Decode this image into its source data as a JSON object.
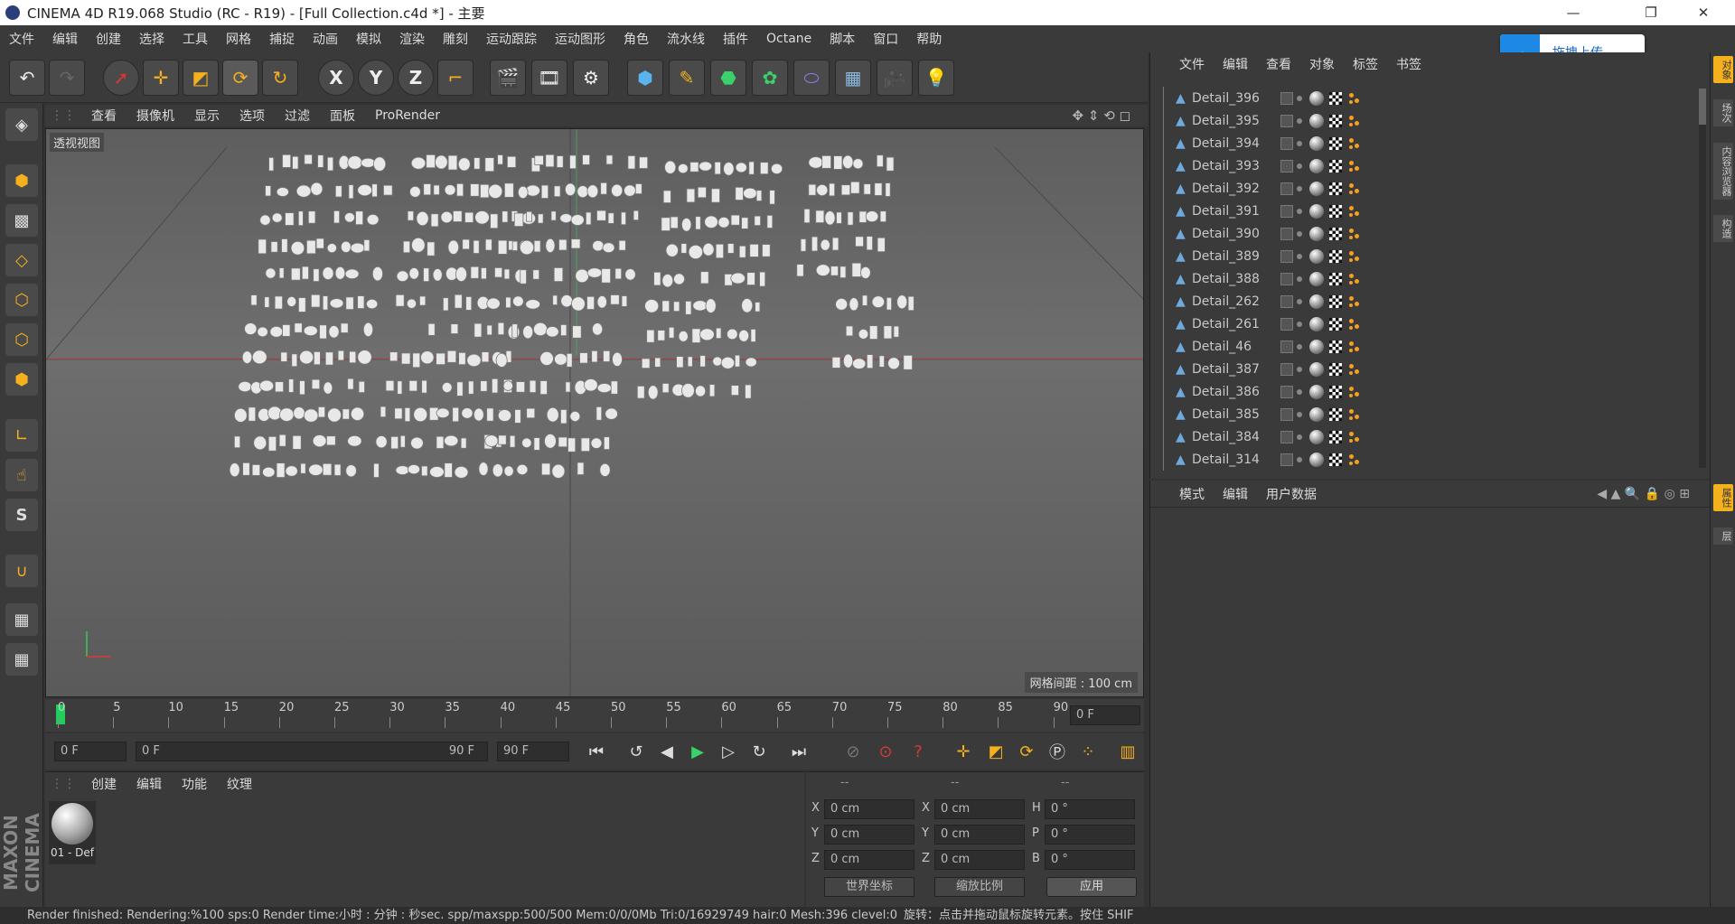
{
  "window": {
    "title": "CINEMA 4D R19.068 Studio (RC - R19) - [Full Collection.c4d *] - 主要",
    "minimize": "—",
    "restore": "❐",
    "close": "✕"
  },
  "menu": [
    "文件",
    "编辑",
    "创建",
    "选择",
    "工具",
    "网格",
    "捕捉",
    "动画",
    "模拟",
    "渲染",
    "雕刻",
    "运动跟踪",
    "运动图形",
    "角色",
    "流水线",
    "插件",
    "Octane",
    "脚本",
    "窗口",
    "帮助"
  ],
  "cloud_upload": {
    "label": "拖拽上传"
  },
  "viewport": {
    "menu": [
      "查看",
      "摄像机",
      "显示",
      "选项",
      "过滤",
      "面板",
      "ProRender"
    ],
    "label": "透视视图",
    "grid_spacing": "网格间距 : 100 cm"
  },
  "timeline": {
    "ticks": [
      "0",
      "5",
      "10",
      "15",
      "20",
      "25",
      "30",
      "35",
      "40",
      "45",
      "50",
      "55",
      "60",
      "65",
      "70",
      "75",
      "80",
      "85",
      "90"
    ],
    "current_frame_field": "0 F",
    "start_field": "0 F",
    "range_start": "0 F",
    "range_end": "90 F",
    "end_field": "90 F"
  },
  "material_panel": {
    "tabs": [
      "创建",
      "编辑",
      "功能",
      "纹理"
    ],
    "material_name": "01 - Def"
  },
  "coord_panel": {
    "headers": [
      "--",
      "--",
      "--"
    ],
    "rows": [
      {
        "a": "X",
        "a_val": "0 cm",
        "b": "X",
        "b_val": "0 cm",
        "c": "H",
        "c_val": "0 °"
      },
      {
        "a": "Y",
        "a_val": "0 cm",
        "b": "Y",
        "b_val": "0 cm",
        "c": "P",
        "c_val": "0 °"
      },
      {
        "a": "Z",
        "a_val": "0 cm",
        "b": "Z",
        "b_val": "0 cm",
        "c": "B",
        "c_val": "0 °"
      }
    ],
    "world_coords": "世界坐标",
    "scale_mode": "缩放比例",
    "apply": "应用"
  },
  "object_panel": {
    "tabs": [
      "文件",
      "编辑",
      "查看",
      "对象",
      "标签",
      "书签"
    ],
    "objects": [
      "Detail_396",
      "Detail_395",
      "Detail_394",
      "Detail_393",
      "Detail_392",
      "Detail_391",
      "Detail_390",
      "Detail_389",
      "Detail_388",
      "Detail_262",
      "Detail_261",
      "Detail_46",
      "Detail_387",
      "Detail_386",
      "Detail_385",
      "Detail_384",
      "Detail_314"
    ]
  },
  "attr_panel": {
    "tabs": [
      "模式",
      "编辑",
      "用户数据"
    ]
  },
  "right_tabs": [
    "对象",
    "场次",
    "内容浏览器",
    "构造",
    "属性",
    "层"
  ],
  "brand": "MAXON CINEMA 4D",
  "status": "Render finished: Rendering:%100 sps:0 Render time:小时 : 分钟 : 秒sec. spp/maxspp:500/500 Mem:0/0/0Mb Tri:0/16929749 hair:0 Mesh:396 clevel:0",
  "status_right": "旋转：点击并拖动鼠标旋转元素。按住 SHIF",
  "colors": {
    "accent_blue": "#1e88e5",
    "timeline_marker": "#1fcf5a",
    "axis_red": "#d83a3a",
    "axis_green": "#3ac75a"
  }
}
